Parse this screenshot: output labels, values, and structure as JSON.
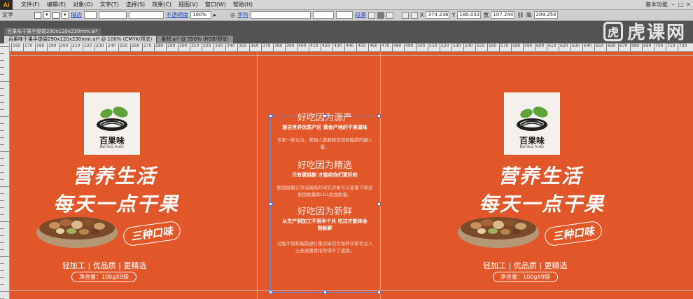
{
  "app": {
    "logo": "Ai"
  },
  "menu": [
    "文件(F)",
    "编辑(E)",
    "对象(O)",
    "文字(T)",
    "选择(S)",
    "效果(C)",
    "视图(V)",
    "窗口(W)",
    "帮助(H)"
  ],
  "workspace_label": "基本功能",
  "control": {
    "tool": "文字",
    "stroke_label": "描边",
    "opacity_label": "不透明度",
    "opacity_value": "100%",
    "char_label": "字符",
    "para_label": "段落",
    "x_label": "X",
    "x_value": "374.236",
    "y_label": "Y",
    "y_value": "180.032",
    "w_label": "宽",
    "w_value": "107.244",
    "h_label": "高",
    "h_value": "209.254"
  },
  "watermark": {
    "text": "虎课网",
    "logo_char": "虎"
  },
  "document": {
    "file_label": "百果味干果手提袋290x120x230mm.ai*",
    "tabs": [
      {
        "label": "百果味干果手提袋290x120x230mm.ai* @ 100% (CMYK/预览)",
        "active": true
      },
      {
        "label": "素材.ai* @ 350% (RGB/预览)",
        "active": false
      }
    ]
  },
  "ruler_ticks": [
    "160",
    "170",
    "180",
    "190",
    "200",
    "210",
    "220",
    "230",
    "240",
    "250",
    "260",
    "270",
    "280",
    "290",
    "300",
    "310",
    "320",
    "330",
    "340",
    "350",
    "360",
    "370",
    "380",
    "390",
    "400",
    "410",
    "420",
    "430",
    "440",
    "450",
    "460",
    "470",
    "480",
    "490",
    "500",
    "510",
    "520",
    "530",
    "540",
    "550",
    "560",
    "570",
    "580",
    "590",
    "600",
    "610",
    "620",
    "630",
    "640",
    "650",
    "660",
    "670",
    "680",
    "690",
    "700",
    "710",
    "720"
  ],
  "panel_left": {
    "brand_cn": "百果味",
    "brand_en": "Bai Guo fruity",
    "slogan_line1": "营养生活",
    "slogan_line2": "每天一点干果",
    "badge": "三种口味",
    "tagline": "轻加工 | 优品质 | 更精选",
    "net": "净含量：100gX9袋"
  },
  "panel_right": {
    "brand_cn": "百果味",
    "brand_en": "Bai Guo fruity",
    "slogan_line1": "营养生活",
    "slogan_line2": "每天一点干果",
    "badge": "三种口味",
    "tagline": "轻加工 | 优品质 | 更精选",
    "net": "净含量：100gX9袋"
  },
  "center": {
    "h1": "好吃因为源产",
    "s1": "源自世界优质产区 黄金产地的干果滋味",
    "p1": "专家一致认为，美国人需要降低饱和脂肪的摄入量。",
    "h2": "好吃因为精选",
    "s2": "只有更挑剔 才能给你们更好的",
    "p2": "胆固醇量正常或偏高的研究对象可以显著下降总胆固醇量和LDL胆固醇量。",
    "h3": "好吃因为新鲜",
    "s3": "从生产到加工不到半个月 吃过才能体会到新鲜",
    "p3": "对脂不饱和脂肪进行重点研究为营养学和专业人士改进膳食指导铺平了道路。"
  },
  "colors": {
    "canvas": "#e1572a",
    "leaf": "#5fa33b",
    "frame": "#6f88d8"
  }
}
